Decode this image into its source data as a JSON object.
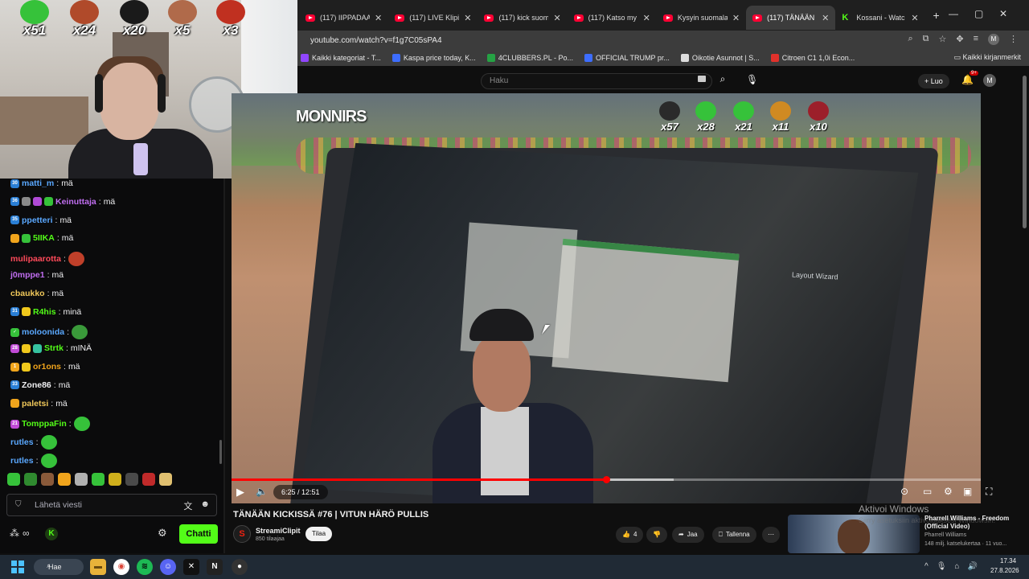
{
  "browser": {
    "tabs": [
      {
        "title": "(117) IIPPADAA",
        "favicon": "youtube"
      },
      {
        "title": "(117) LIVE Klipi",
        "favicon": "youtube"
      },
      {
        "title": "(117) kick suomi",
        "favicon": "youtube"
      },
      {
        "title": "(117) Katso my",
        "favicon": "youtube"
      },
      {
        "title": "Kysyin suomala",
        "favicon": "youtube"
      },
      {
        "title": "(117) TÄNÄÄN",
        "favicon": "youtube",
        "active": true
      },
      {
        "title": "Kossani - Watc",
        "favicon": "kick"
      }
    ],
    "new_tab": "+",
    "window_controls": {
      "minimize": "—",
      "maximize": "▢",
      "close": "✕"
    },
    "url": "youtube.com/watch?v=f1g7C05sPA4",
    "profile_initial": "M",
    "bookmarks": [
      {
        "label": "Kaikki kategoriat - T...",
        "color": "#9146ff"
      },
      {
        "label": "Kaspa price today, K...",
        "color": "#3d6dff"
      },
      {
        "label": "4CLUBBERS.PL - Po...",
        "color": "#25a244"
      },
      {
        "label": "OFFICIAL TRUMP pr...",
        "color": "#3d6dff"
      },
      {
        "label": "Oikotie Asunnot | S...",
        "color": "#dddddd"
      },
      {
        "label": "Citroen C1 1,0i Econ...",
        "color": "#e0312b"
      }
    ],
    "bookmarks_all": "Kaikki kirjanmerkit"
  },
  "youtube": {
    "search_placeholder": "Haku",
    "create_label": "Luo",
    "notification_count": "9+",
    "avatar_initial": "M",
    "video": {
      "overlay_channel_tag": "MONNIRS",
      "overlay_emotes": [
        {
          "mult": "x57",
          "color": "#2a2a2a"
        },
        {
          "mult": "x28",
          "color": "#36c23a"
        },
        {
          "mult": "x21",
          "color": "#36c23a"
        },
        {
          "mult": "x11",
          "color": "#d08a22"
        },
        {
          "mult": "x10",
          "color": "#9c1f2a"
        }
      ],
      "layout_wizard_text": "Layout Wizard",
      "current_time": "6:25",
      "duration": "12:51",
      "time_display": "6:25 / 12:51",
      "progress": 0.5,
      "buffered": 0.59
    },
    "title": "TÄNÄÄN KICKISSÄ #76 | VITUN HÄRÖ PULLIS",
    "channel": {
      "name": "StreamiClipit",
      "subscribers": "850 tilaajaa",
      "avatar_letter": "S"
    },
    "subscribe_label": "Tilaa",
    "actions": {
      "likes": "4",
      "share": "Jaa",
      "save": "Tallenna",
      "more": "⋯"
    },
    "watermark": {
      "title": "Aktivoi Windows",
      "subtitle": "Siirry asetuksiin aktivoidaksesi Windowsin."
    },
    "recommended": {
      "title": "Pharrell Williams - Freedom (Official Video)",
      "channel": "Pharrell Williams",
      "meta": "148 milj. katselukertaa · 11 vuo..."
    }
  },
  "stream": {
    "webcam_emotes": [
      {
        "mult": "x51",
        "color": "#36c23a"
      },
      {
        "mult": "x24",
        "color": "#b04a2a"
      },
      {
        "mult": "x20",
        "color": "#1a1a1a"
      },
      {
        "mult": "x5",
        "color": "#b06a4a"
      },
      {
        "mult": "x3",
        "color": "#c03020"
      }
    ],
    "chat": {
      "messages": [
        {
          "badges": [
            "#2a7fd6"
          ],
          "badge_text": [
            "30"
          ],
          "user": "matti_m",
          "user_color": "#5aa8ff",
          "text": "mä",
          "emote": null
        },
        {
          "badges": [
            "#2a7fd6",
            "#8a8a8a",
            "#b04ad6",
            "#36c23a"
          ],
          "badge_text": [
            "36",
            "",
            "",
            ""
          ],
          "user": "Keinuttaja",
          "user_color": "#c06ef0",
          "text": "mä",
          "emote": null
        },
        {
          "badges": [
            "#2a7fd6"
          ],
          "badge_text": [
            "35"
          ],
          "user": "ppetteri",
          "user_color": "#5aa8ff",
          "text": "mä",
          "emote": null
        },
        {
          "badges": [
            "#f0a41c",
            "#36c23a"
          ],
          "badge_text": [
            "",
            ""
          ],
          "user": "5IIKA",
          "user_color": "#53fc18",
          "text": "mä",
          "emote": null
        },
        {
          "badges": [],
          "badge_text": [],
          "user": "mulipaarotta",
          "user_color": "#ff4a5a",
          "text": "",
          "emote": "#c0402a"
        },
        {
          "badges": [],
          "badge_text": [],
          "user": "j0mppe1",
          "user_color": "#c06ef0",
          "text": "mä",
          "emote": null
        },
        {
          "badges": [],
          "badge_text": [],
          "user": "cbaukko",
          "user_color": "#f0c85a",
          "text": "mä",
          "emote": null
        },
        {
          "badges": [
            "#2a7fd6",
            "#f0c81c"
          ],
          "badge_text": [
            "31",
            ""
          ],
          "user": "R4his",
          "user_color": "#53fc18",
          "text": "minä",
          "emote": null
        },
        {
          "badges": [
            "#36c23a"
          ],
          "badge_text": [
            "✓"
          ],
          "user": "moloonida",
          "user_color": "#5aa8ff",
          "text": "",
          "emote": "#3a9a3a"
        },
        {
          "badges": [
            "#c04ad6",
            "#f0c81c",
            "#36c2a0"
          ],
          "badge_text": [
            "28",
            "",
            ""
          ],
          "user": "Strtk",
          "user_color": "#53fc18",
          "text": "mINÄ",
          "emote": null
        },
        {
          "badges": [
            "#f0a41c",
            "#f0c81c"
          ],
          "badge_text": [
            "1",
            ""
          ],
          "user": "or1ons",
          "user_color": "#f0a41c",
          "text": "mä",
          "emote": null
        },
        {
          "badges": [
            "#2a7fd6"
          ],
          "badge_text": [
            "33"
          ],
          "user": "Zone86",
          "user_color": "#efeff1",
          "text": "mä",
          "emote": null
        },
        {
          "badges": [
            "#f0a41c"
          ],
          "badge_text": [
            ""
          ],
          "user": "paletsi",
          "user_color": "#f0c85a",
          "text": "mä",
          "emote": null
        },
        {
          "badges": [
            "#c04ad6"
          ],
          "badge_text": [
            "21"
          ],
          "user": "TomppaFin",
          "user_color": "#53fc18",
          "text": "",
          "emote": "#36c23a"
        },
        {
          "badges": [],
          "badge_text": [],
          "user": "rutles",
          "user_color": "#5aa8ff",
          "text": "",
          "emote": "#36c23a"
        },
        {
          "badges": [],
          "badge_text": [],
          "user": "rutles",
          "user_color": "#5aa8ff",
          "text": "",
          "emote": "#36c23a"
        }
      ],
      "emote_tray_colors": [
        "#36c23a",
        "#2f8a2f",
        "#8a5a3a",
        "#f0a41c",
        "#b0b0b0",
        "#36c23a",
        "#d0b01c",
        "#4a4a4a",
        "#c02a2a",
        "#e0c070"
      ],
      "input_placeholder": "Lähetä viesti",
      "send_label": "Chatti"
    }
  },
  "taskbar": {
    "search_label": "Hae",
    "time": "17.34",
    "date": "27.8.2026"
  }
}
